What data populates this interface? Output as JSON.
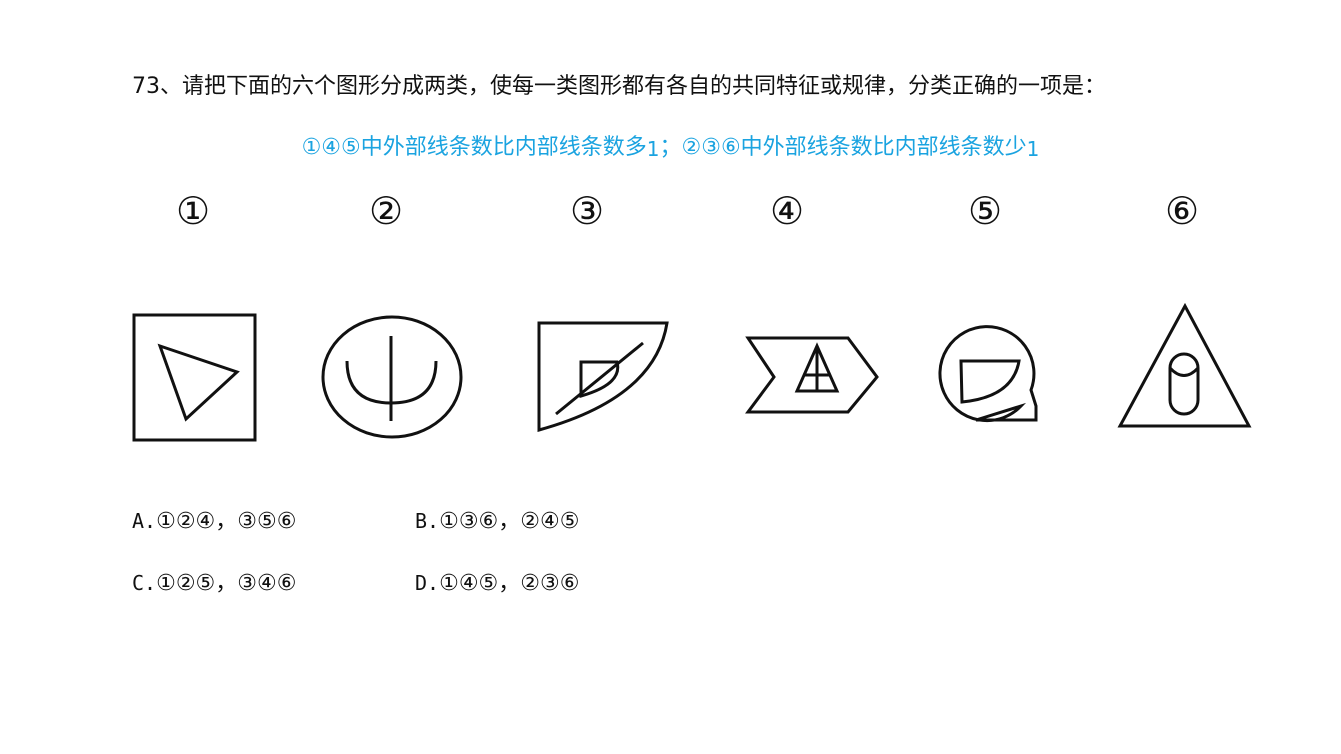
{
  "question": {
    "text": "73、请把下面的六个图形分成两类，使每一类图形都有各自的共同特征或规律，分类正确的一项是："
  },
  "hint": {
    "part1": "①④⑤中外部线条数比内部线条数多",
    "part1_num": "1",
    "separator": "；",
    "part2": "②③⑥中外部线条数比内部线条数少",
    "part2_num": "1",
    "color": "#1aa3e0"
  },
  "figures": {
    "labels": [
      "①",
      "②",
      "③",
      "④",
      "⑤",
      "⑥"
    ]
  },
  "options": [
    {
      "letter": "A.",
      "text": "①②④，③⑤⑥"
    },
    {
      "letter": "B.",
      "text": "①③⑥，②④⑤"
    },
    {
      "letter": "C.",
      "text": "①②⑤，③④⑥"
    },
    {
      "letter": "D.",
      "text": "①④⑤，②③⑥"
    }
  ]
}
